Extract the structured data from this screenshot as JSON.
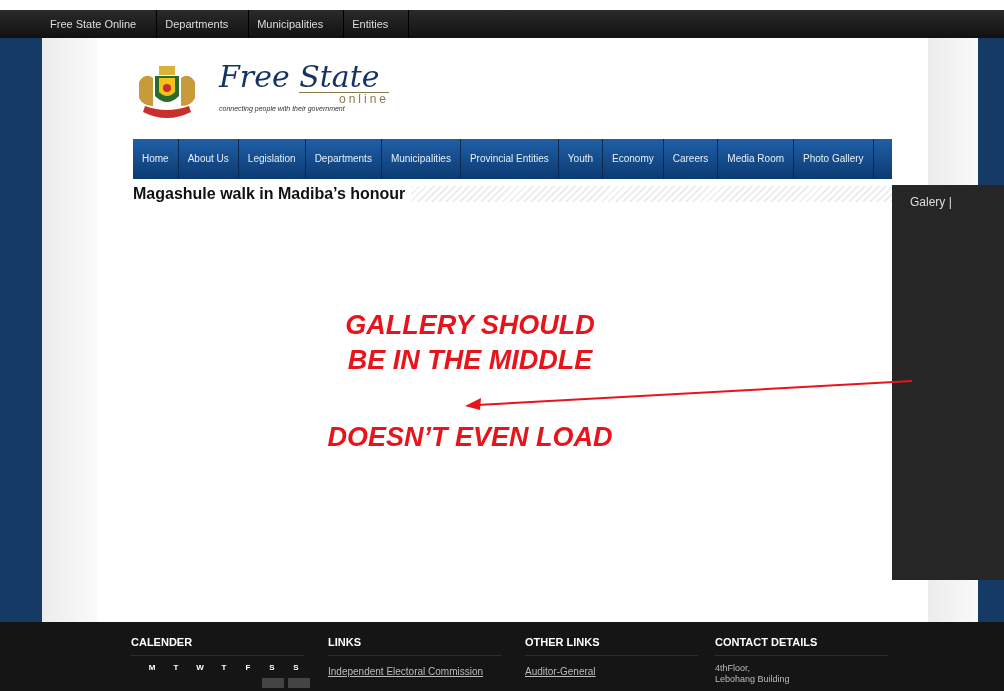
{
  "top_nav": [
    {
      "label": "Free State Online"
    },
    {
      "label": "Departments"
    },
    {
      "label": "Municipalities"
    },
    {
      "label": "Entities"
    }
  ],
  "logo": {
    "title": "Free State",
    "subtitle": "online",
    "tagline": "connecting people with their government"
  },
  "main_menu": [
    {
      "label": "Home"
    },
    {
      "label": "About Us"
    },
    {
      "label": "Legislation"
    },
    {
      "label": "Departments"
    },
    {
      "label": "Municipalities"
    },
    {
      "label": "Provincial Entities"
    },
    {
      "label": "Youth"
    },
    {
      "label": "Economy"
    },
    {
      "label": "Careers"
    },
    {
      "label": "Media Room"
    },
    {
      "label": "Photo Gallery"
    }
  ],
  "article_title": "Magashule walk in Madiba’s honour",
  "gallery_panel": {
    "label": "Galery |"
  },
  "annotations": [
    "GALLERY SHOULD",
    "BE IN THE MIDDLE",
    "DOESN’T EVEN LOAD"
  ],
  "footer": {
    "calendar": {
      "title": "CALENDER",
      "days": [
        "M",
        "T",
        "W",
        "T",
        "F",
        "S",
        "S"
      ]
    },
    "links": {
      "title": "LINKS",
      "items": [
        "Independent Electoral Commission"
      ]
    },
    "other_links": {
      "title": "OTHER LINKS",
      "items": [
        "Auditor-General"
      ]
    },
    "contact": {
      "title": "CONTACT DETAILS",
      "lines": [
        "4thFloor,",
        "Lebohang Building"
      ]
    }
  }
}
